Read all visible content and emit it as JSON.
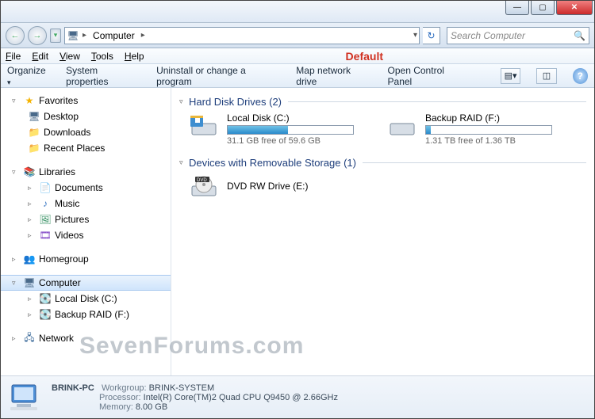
{
  "window": {
    "min": "—",
    "max": "▢",
    "close": "✕"
  },
  "nav": {
    "back": "←",
    "fwd": "→",
    "down": "▾",
    "crumb_root": "Computer",
    "crumb_sep": "▸",
    "refresh": "↻",
    "search_placeholder": "Search Computer",
    "search_icon": "🔍"
  },
  "menu": {
    "file": "File",
    "edit": "Edit",
    "view": "View",
    "tools": "Tools",
    "help": "Help",
    "annotation": "Default"
  },
  "toolbar": {
    "organize": "Organize",
    "sysprops": "System properties",
    "uninstall": "Uninstall or change a program",
    "mapdrive": "Map network drive",
    "opencp": "Open Control Panel",
    "view_icon": "▤▾",
    "preview_icon": "◫",
    "help": "?"
  },
  "sidebar": {
    "favorites": "Favorites",
    "desktop": "Desktop",
    "downloads": "Downloads",
    "recent": "Recent Places",
    "libraries": "Libraries",
    "documents": "Documents",
    "music": "Music",
    "pictures": "Pictures",
    "videos": "Videos",
    "homegroup": "Homegroup",
    "computer": "Computer",
    "localdisk": "Local Disk (C:)",
    "backup": "Backup RAID (F:)",
    "network": "Network"
  },
  "groups": {
    "hdd": "Hard Disk Drives (2)",
    "removable": "Devices with Removable Storage (1)"
  },
  "drives": {
    "c": {
      "name": "Local Disk (C:)",
      "free_text": "31.1 GB free of 59.6 GB",
      "fill_pct": 48
    },
    "f": {
      "name": "Backup RAID (F:)",
      "free_text": "1.31 TB free of 1.36 TB",
      "fill_pct": 4
    },
    "e": {
      "name": "DVD RW Drive (E:)"
    }
  },
  "details": {
    "name": "BRINK-PC",
    "workgroup_k": "Workgroup:",
    "workgroup_v": "BRINK-SYSTEM",
    "processor_k": "Processor:",
    "processor_v": "Intel(R) Core(TM)2 Quad  CPU   Q9450  @ 2.66GHz",
    "memory_k": "Memory:",
    "memory_v": "8.00 GB"
  },
  "watermark": "SevenForums.com"
}
